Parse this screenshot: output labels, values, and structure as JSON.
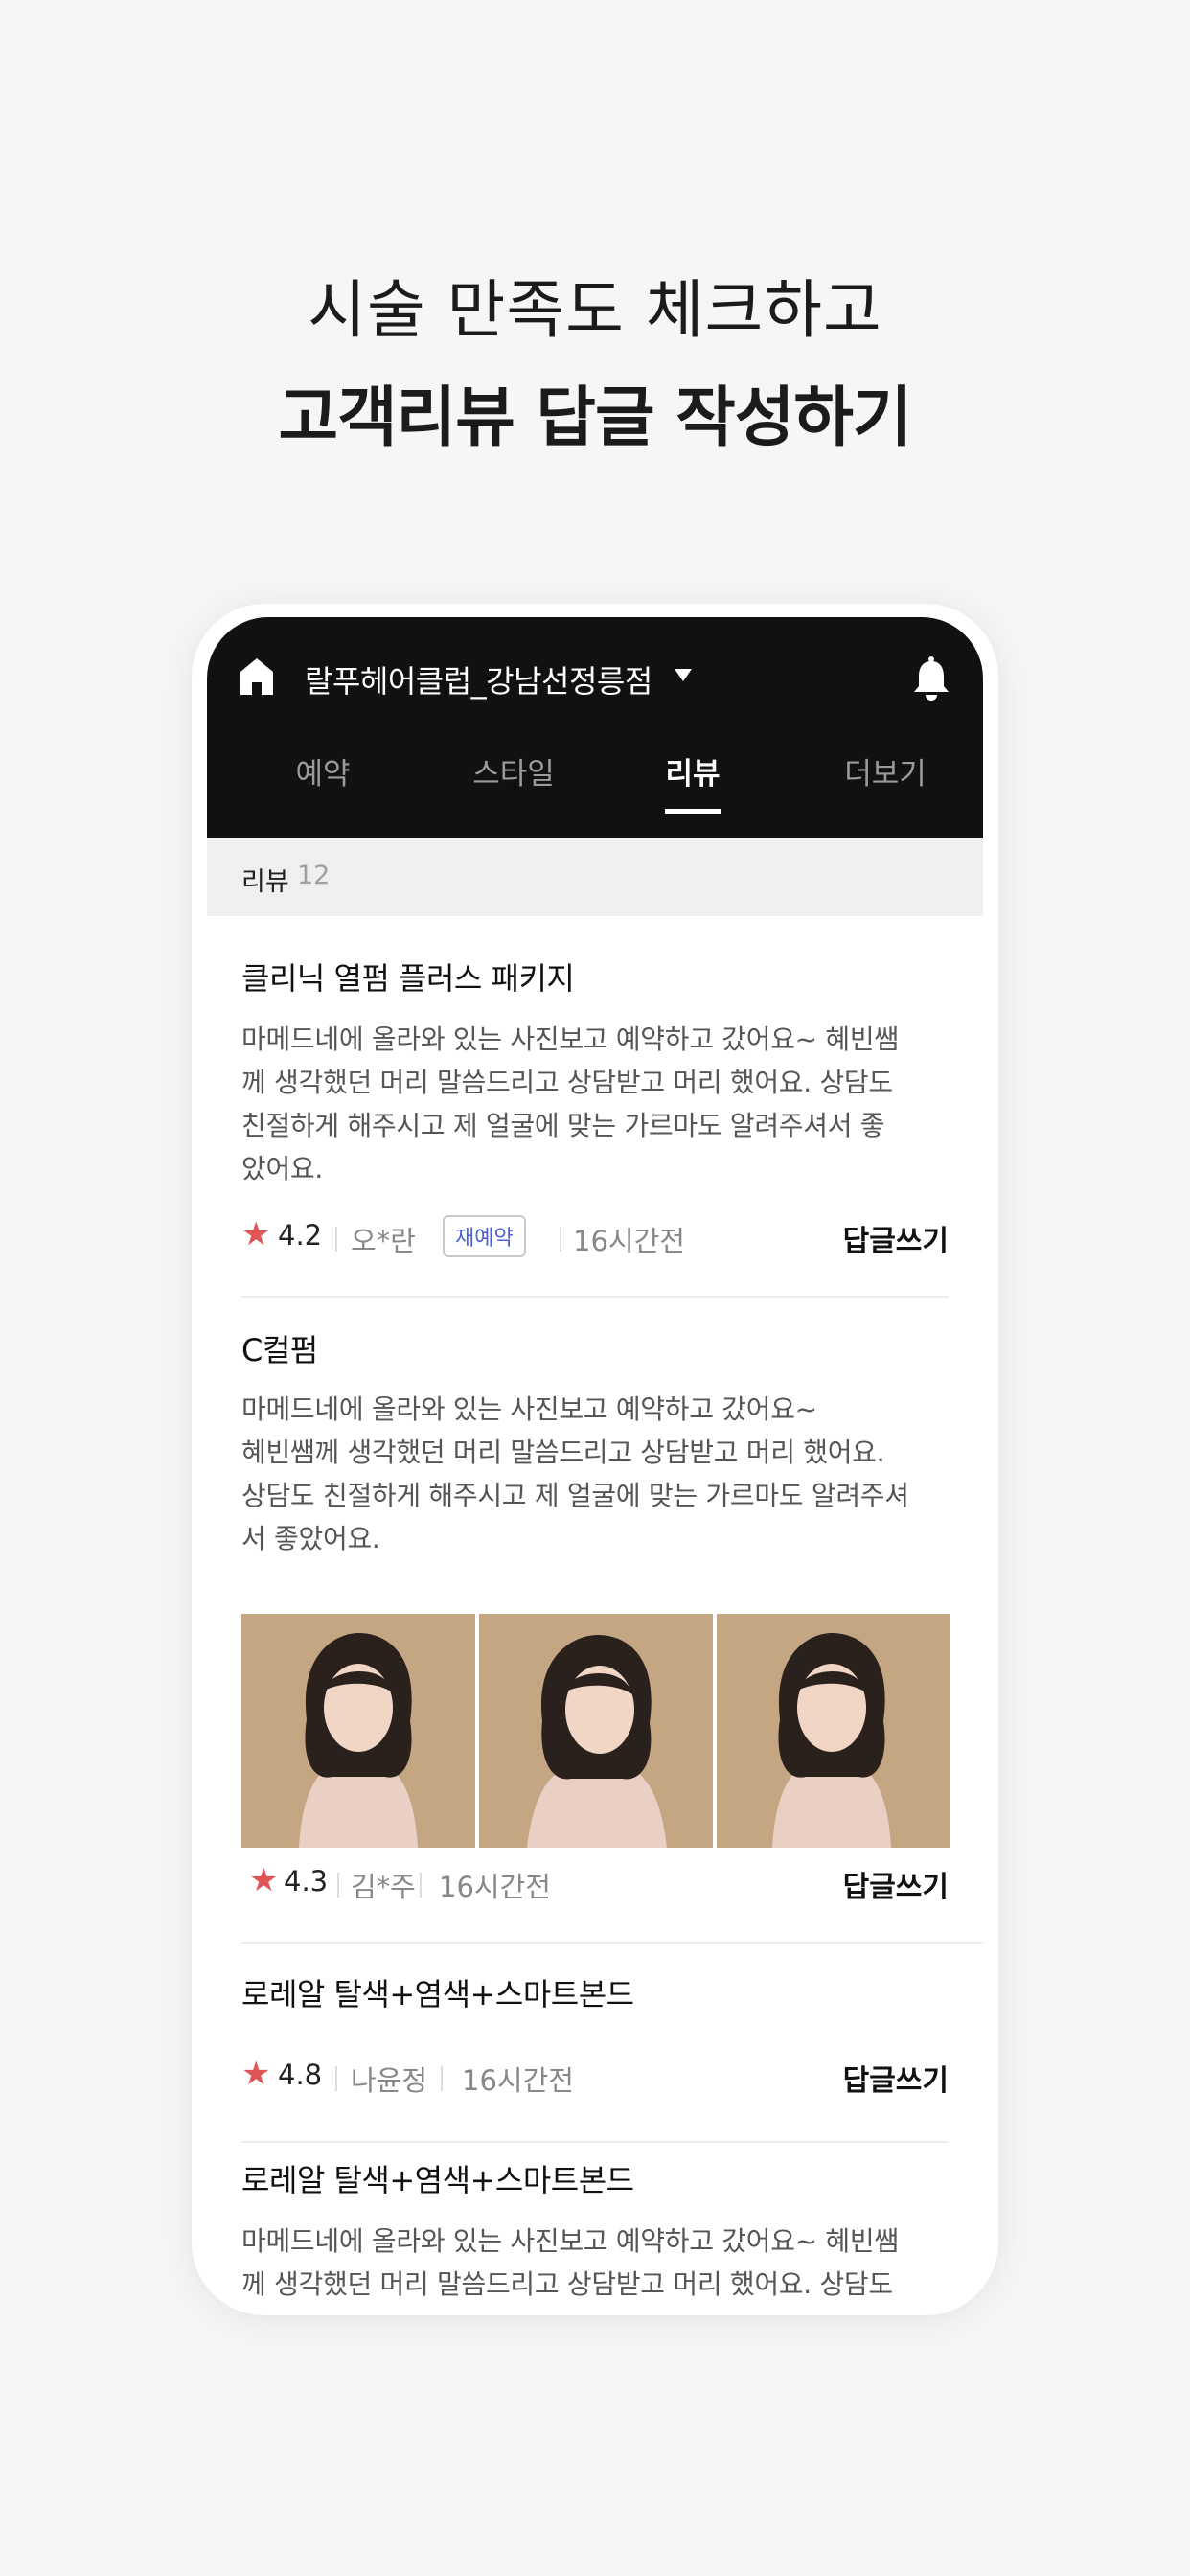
{
  "headline": {
    "line1": "시술 만족도 체크하고",
    "line2": "고객리뷰 답글 작성하기"
  },
  "app": {
    "shop_name": "랄푸헤어클럽_강남선정릉점",
    "icons": {
      "home": "home-icon",
      "caret": "caret-down-icon",
      "bell": "bell-icon"
    },
    "tabs": [
      {
        "label": "예약",
        "active": false
      },
      {
        "label": "스타일",
        "active": false
      },
      {
        "label": "리뷰",
        "active": true
      },
      {
        "label": "더보기",
        "active": false
      }
    ]
  },
  "review_header": {
    "label": "리뷰",
    "count": "12"
  },
  "reviews": [
    {
      "title": "클리닉 열펌 플러스 패키지",
      "body_lines": [
        "마메드네에 올라와 있는 사진보고 예약하고 갔어요~ 혜빈쌤",
        "께 생각했던 머리 말씀드리고 상담받고 머리 했어요. 상담도",
        "친절하게 해주시고 제 얼굴에 맞는 가르마도 알려주셔서 좋",
        "았어요."
      ],
      "rating": "4.2",
      "author": "오*란",
      "badge": "재예약",
      "time": "16시간전",
      "reply_label": "답글쓰기"
    },
    {
      "title": "C컬펌",
      "body_lines": [
        "마메드네에 올라와 있는 사진보고 예약하고 갔어요~",
        "혜빈쌤께 생각했던 머리 말씀드리고 상담받고 머리 했어요.",
        "상담도 친절하게 해주시고 제 얼굴에 맞는 가르마도 알려주셔",
        "서 좋았어요."
      ],
      "photo_count": 3,
      "rating": "4.3",
      "author": "김*주",
      "time": "16시간전",
      "reply_label": "답글쓰기"
    },
    {
      "title": "로레알 탈색+염색+스마트본드",
      "rating": "4.8",
      "author": "나윤정",
      "time": "16시간전",
      "reply_label": "답글쓰기"
    },
    {
      "title": "로레알 탈색+염색+스마트본드",
      "body_lines": [
        "마메드네에 올라와 있는 사진보고 예약하고 갔어요~ 혜빈쌤",
        "께 생각했던 머리 말씀드리고 상담받고 머리 했어요. 상담도"
      ]
    }
  ],
  "colors": {
    "background": "#f6f6f6",
    "appbar": "#111111",
    "star": "#e05555",
    "badge_text": "#4b5ed6"
  }
}
